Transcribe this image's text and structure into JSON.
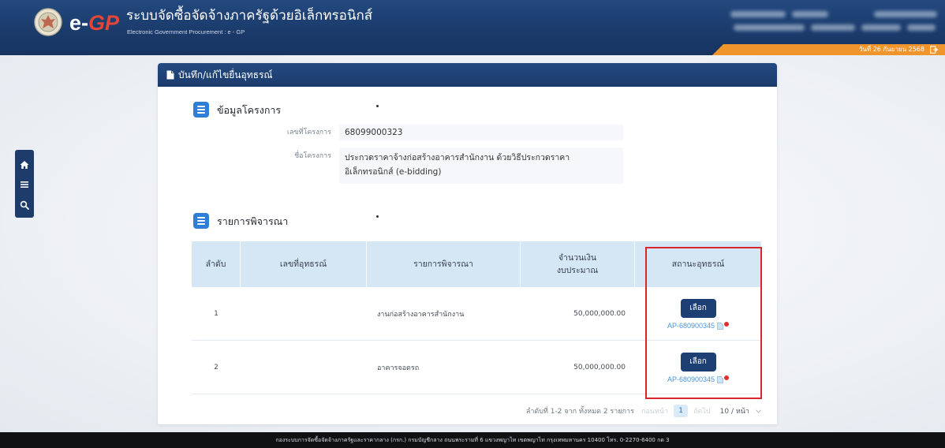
{
  "theme": {
    "header_navy": "#1d3c6b",
    "accent_orange": "#ef952c",
    "logo_red": "#e2463b",
    "section_icon_blue": "#2e7fd5",
    "table_header_blue": "#d5e7f4",
    "button_navy": "#1e3f74",
    "link_blue": "#4a94d8",
    "highlight_red": "#d8262b",
    "footer_black": "#0f1113"
  },
  "header": {
    "emblem_icon": "garuda-emblem-icon",
    "logo_e": "e-",
    "logo_gp": "GP",
    "title": "ระบบจัดซื้อจัดจ้างภาครัฐด้วยอิเล็กทรอนิกส์",
    "subtitle": "Electronic Government Procurement : e - GP",
    "date": "วันที่ 26 กันยายน 2568",
    "date_icon": "logout-icon"
  },
  "side_toolbar": {
    "items": [
      {
        "icon": "home-icon"
      },
      {
        "icon": "menu-icon"
      },
      {
        "icon": "search-icon"
      }
    ]
  },
  "form": {
    "title": "บันทึก/แก้ไขยื่นอุทธรณ์",
    "title_icon": "document-icon",
    "project_section": {
      "heading": "ข้อมูลโครงการ",
      "icon": "list-icon",
      "project_number_label": "เลขที่โครงการ",
      "project_number": "68099000323",
      "project_name_label": "ชื่อโครงการ",
      "project_name_line1": "ประกวดราคาจ้างก่อสร้างอาคารสำนักงาน ด้วยวิธีประกวดราคา",
      "project_name_line2": "อิเล็กทรอนิกส์ (e-bidding)"
    },
    "items_section": {
      "heading": "รายการพิจารณา",
      "icon": "list-icon",
      "columns": {
        "no": "ลำดับ",
        "appeal_no": "เลขที่อุทธรณ์",
        "item": "รายการพิจารณา",
        "budget_line1": "จำนวนเงิน",
        "budget_line2": "งบประมาณ",
        "status": "สถานะอุทธรณ์"
      },
      "rows": [
        {
          "no": "1",
          "item": "งานก่อสร้างอาคารสำนักงาน",
          "budget": "50,000,000.00",
          "select_label": "เลือก",
          "appeal_link": "AP-680900345"
        },
        {
          "no": "2",
          "item": "อาคารจอดรถ",
          "budget": "50,000,000.00",
          "select_label": "เลือก",
          "appeal_link": "AP-680900345"
        }
      ],
      "link_icons": [
        "file-icon",
        "red-dot-icon"
      ],
      "pagination": {
        "summary": "ลำดับที่ 1-2 จาก ทั้งหมด 2 รายการ",
        "prev_label": "ก่อนหน้า",
        "current_page": "1",
        "next_label": "ถัดไป",
        "page_size": "10 / หน้า"
      }
    }
  },
  "footer": {
    "text": "กองระบบการจัดซื้อจัดจ้างภาครัฐและราคากลาง (กรก.) กรมบัญชีกลาง ถนนพระรามที่ 6 แขวงพญาไท เขตพญาไท กรุงเทพมหานคร 10400 โทร. 0-2270-6400 กด 3"
  }
}
